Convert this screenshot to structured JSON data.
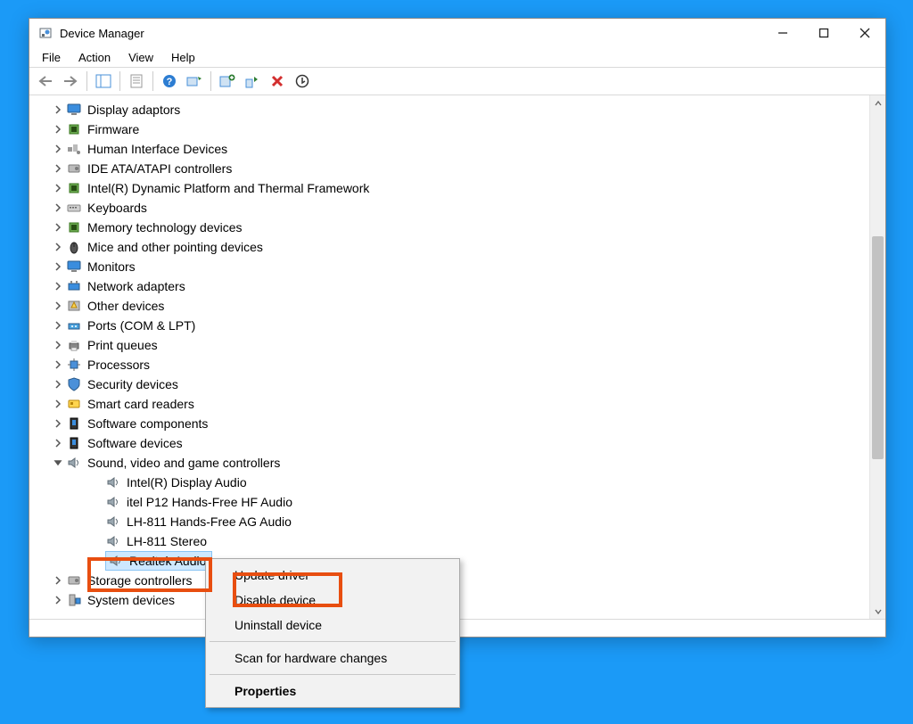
{
  "window": {
    "title": "Device Manager"
  },
  "menu": {
    "file": "File",
    "action": "Action",
    "view": "View",
    "help": "Help"
  },
  "categories": [
    {
      "icon": "monitor",
      "label": "Display adaptors"
    },
    {
      "icon": "chip",
      "label": "Firmware"
    },
    {
      "icon": "hid",
      "label": "Human Interface Devices"
    },
    {
      "icon": "disk",
      "label": "IDE ATA/ATAPI controllers"
    },
    {
      "icon": "chip",
      "label": "Intel(R) Dynamic Platform and Thermal Framework"
    },
    {
      "icon": "keyboard",
      "label": "Keyboards"
    },
    {
      "icon": "chip",
      "label": "Memory technology devices"
    },
    {
      "icon": "mouse",
      "label": "Mice and other pointing devices"
    },
    {
      "icon": "monitor",
      "label": "Monitors"
    },
    {
      "icon": "net",
      "label": "Network adapters"
    },
    {
      "icon": "warn",
      "label": "Other devices"
    },
    {
      "icon": "port",
      "label": "Ports (COM & LPT)"
    },
    {
      "icon": "printer",
      "label": "Print queues"
    },
    {
      "icon": "cpu",
      "label": "Processors"
    },
    {
      "icon": "shield",
      "label": "Security devices"
    },
    {
      "icon": "card",
      "label": "Smart card readers"
    },
    {
      "icon": "sw",
      "label": "Software components"
    },
    {
      "icon": "sw",
      "label": "Software devices"
    }
  ],
  "sound": {
    "label": "Sound, video and game controllers",
    "children": [
      "Intel(R) Display Audio",
      "itel P12 Hands-Free HF Audio",
      "LH-811 Hands-Free AG Audio",
      "LH-811 Stereo",
      "Realtek Audio"
    ]
  },
  "after": [
    {
      "icon": "disk",
      "label": "Storage controllers"
    },
    {
      "icon": "pc",
      "label": "System devices"
    }
  ],
  "ctx": {
    "update": "Update driver",
    "disable": "Disable device",
    "uninstall": "Uninstall device",
    "scan": "Scan for hardware changes",
    "props": "Properties"
  }
}
